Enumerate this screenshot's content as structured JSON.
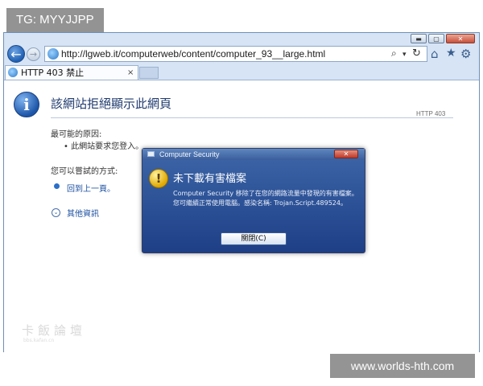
{
  "watermark_top": "TG: MYYJJPP",
  "watermark_bottom": "www.worlds-hth.com",
  "browser": {
    "address_url": "http://lgweb.it/computerweb/content/computer_93__large.html",
    "tab_title": "HTTP 403 禁止",
    "tab_close": "×",
    "window_buttons": {
      "minimize": "▬",
      "maximize": "▢",
      "close": "✕"
    }
  },
  "page": {
    "title": "該網站拒絕顯示此網頁",
    "code": "HTTP 403",
    "causes_heading": "最可能的原因:",
    "causes": [
      "• 此網站要求您登入。"
    ],
    "tries_heading": "您可以嘗試的方式:",
    "back_link": "回到上一頁。",
    "more_info": "其他資訊",
    "watermark_logo": "卡飯論壇",
    "watermark_site": "bbs.kafan.cn"
  },
  "dialog": {
    "title": "Computer Security",
    "close": "✕",
    "heading": "未下載有害檔案",
    "body": "Computer Security 移除了在您的網路流量中發現的有害檔案。您可繼續正常使用電腦。感染名稱: Trojan.Script.489524。",
    "ok_label": "關閉(C)"
  },
  "icons": {
    "back": "←",
    "forward": "→",
    "search": "⌕",
    "dropdown": "▾",
    "refresh": "↻",
    "home": "⌂",
    "star": "★",
    "gear": "⚙",
    "info": "i",
    "warning": "!",
    "more": "⌄"
  }
}
